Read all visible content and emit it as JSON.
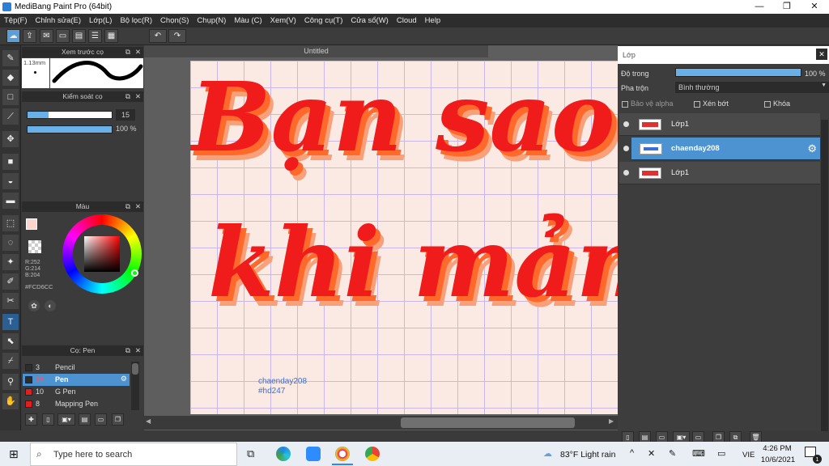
{
  "window": {
    "title": "MediBang Paint Pro (64bit)",
    "minimize": "—",
    "maximize": "❐",
    "close": "✕"
  },
  "menu": [
    "Tệp(F)",
    "Chỉnh sửa(E)",
    "Lớp(L)",
    "Bộ lọc(R)",
    "Chọn(S)",
    "Chụp(N)",
    "Màu (C)",
    "Xem(V)",
    "Công cụ(T)",
    "Cửa sổ(W)",
    "Cloud",
    "Help"
  ],
  "toolbar": {
    "undo": "↶",
    "redo": "↷"
  },
  "brush_preview": {
    "title": "Xem trước cọ",
    "size_label": "1.13mm"
  },
  "brush_control": {
    "title": "Kiểm soát cọ",
    "size_value": "15",
    "opacity_value": "100 %",
    "size_fraction": 0.25,
    "opacity_fraction": 1.0
  },
  "color_panel": {
    "title": "Màu",
    "r": "R:252",
    "g": "G:214",
    "b": "B:204",
    "hex": "#FCD6CC",
    "current_color": "#FCD6CC"
  },
  "brush_list": {
    "title": "Cọ: Pen",
    "items": [
      {
        "num": "3",
        "label": "Pencil",
        "color": "#2d2d2d"
      },
      {
        "num": "15",
        "label": "Pen",
        "color": "#2d2d2d"
      },
      {
        "num": "10",
        "label": "G Pen",
        "color": "#e02020"
      },
      {
        "num": "8",
        "label": "Mapping Pen",
        "color": "#e02020"
      }
    ]
  },
  "canvas": {
    "tab": "Untitled",
    "line1": "Bạn sao l",
    "line2": "khi mảng",
    "watermark_name": "chaenday208",
    "watermark_tag": "#hd247"
  },
  "layers": {
    "title": "Lớp",
    "opacity_label": "Độ trong",
    "opacity_value": "100 %",
    "blend_label": "Pha trộn",
    "blend_value": "Bình thường",
    "protect_alpha": "Bảo vệ alpha",
    "clipping": "Xén bớt",
    "lock": "Khóa",
    "items": [
      {
        "name": "Lớp1",
        "selected": false
      },
      {
        "name": "chaenday208",
        "selected": true
      },
      {
        "name": "Lớp1",
        "selected": false
      }
    ]
  },
  "taskbar": {
    "search_placeholder": "Type here to search",
    "weather": "83°F  Light rain",
    "lang": "VIE",
    "time": "4:26 PM",
    "date": "10/6/2021",
    "notifications": "1"
  }
}
